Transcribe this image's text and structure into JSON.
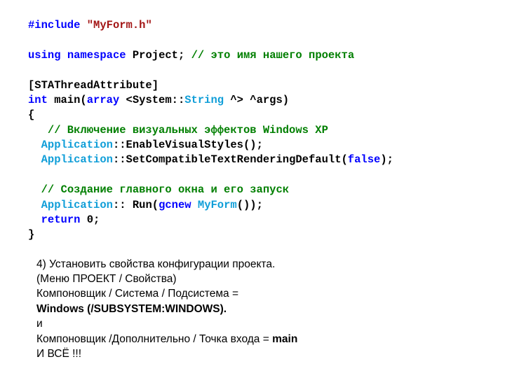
{
  "code": {
    "l1a": "#include",
    "l1b": " ",
    "l1c": "\"MyForm.h\"",
    "l2_blank": "",
    "l3a": "using",
    "l3b": " ",
    "l3c": "namespace",
    "l3d": " ",
    "l3e": "Project;",
    "l3f": " ",
    "l3g": "// это имя нашего проекта",
    "l4_blank": "",
    "l5": "[STAThreadAttribute]",
    "l6a": "int",
    "l6b": " main(",
    "l6c": "array",
    "l6d": " <System::",
    "l6e": "String",
    "l6f": " ^> ^args)",
    "l7": "{",
    "l8a": "   ",
    "l8b": "// Включение визуальных эффектов Windows XP",
    "l9a": "  ",
    "l9b": "Application",
    "l9c": "::EnableVisualStyles();",
    "l10a": "  ",
    "l10b": "Application",
    "l10c": "::SetCompatibleTextRenderingDefault(",
    "l10d": "false",
    "l10e": ");",
    "l11_blank": "",
    "l12a": "  ",
    "l12b": "// Создание главного окна и его запуск",
    "l13a": "  ",
    "l13b": "Application",
    "l13c": ":: Run(",
    "l13d": "gcnew",
    "l13e": " ",
    "l13f": "MyForm",
    "l13g": "());",
    "l14a": "  ",
    "l14b": "return",
    "l14c": " 0;",
    "l15": "}"
  },
  "notes": {
    "n1": "4) Установить свойства конфигурации проекта.",
    "n2": "(Меню ПРОЕКТ /  Свойства)",
    "n3": "Компоновщик /  Система / Подсистема =",
    "n4": "Windows (/SUBSYSTEM:WINDOWS).",
    "n5": "и",
    "n6a": "Компоновщик /Дополнительно / Точка входа = ",
    "n6b": "main",
    "n7": "И ВСЁ !!!"
  }
}
